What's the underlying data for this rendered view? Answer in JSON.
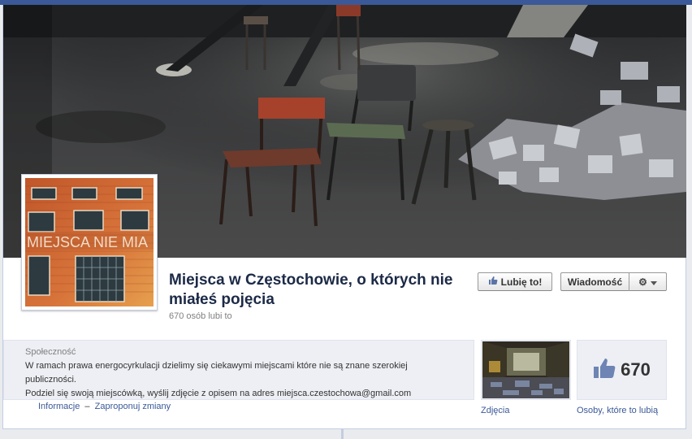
{
  "page": {
    "name": "Miejsca w Częstochowie, o których nie miałeś pojęcia",
    "likes_summary": "670 osób lubi to"
  },
  "profile_picture": {
    "sign_text": "MIEJSCA NIE MIA"
  },
  "actions": {
    "like_label": "Lubię to!",
    "message_label": "Wiadomość"
  },
  "about": {
    "category": "Społeczność",
    "description_line1": "W ramach prawa energocyrkulacji dzielimy się ciekawymi miejscami które nie są znane szerokiej publiczności.",
    "description_line2": "Podziel się swoją miejscówką, wyślij zdjęcie z opisem na adres miejsca.czestochowa@gmail.com"
  },
  "links": {
    "info": "Informacje",
    "separator": "–",
    "suggest": "Zaproponuj zmiany"
  },
  "apps": {
    "photos_label": "Zdjęcia",
    "likes_count": "670",
    "likes_label": "Osoby, które to lubią"
  },
  "colors": {
    "brand": "#3b5998",
    "title": "#1c2a47",
    "muted": "#808080"
  },
  "icons": {
    "like": "thumbs-up-icon",
    "settings": "gear-icon",
    "dropdown": "caret-down-icon",
    "likes_box": "thumbs-up-icon"
  }
}
